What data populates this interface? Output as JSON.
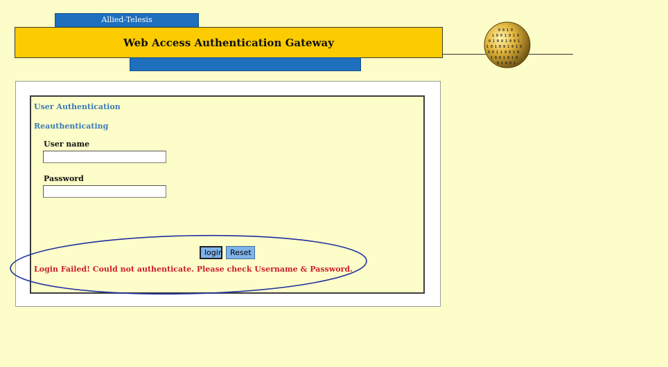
{
  "header": {
    "vendor": "Allied-Telesis",
    "title": "Web Access Authentication Gateway"
  },
  "form": {
    "heading": "User Authentication",
    "subheading": "Reauthenticating",
    "username_label": "User name",
    "username_value": "",
    "password_label": "Password",
    "password_value": "",
    "login_label": "login",
    "reset_label": "Reset",
    "error_message": "Login Failed! Could not authenticate. Please check Username & Password."
  },
  "colors": {
    "background": "#fdfdc9",
    "title_bar": "#fccb00",
    "tab_blue": "#1e6fbd",
    "heading_blue": "#3b7bb5",
    "error_red": "#cc1f2f",
    "annotation_ellipse": "#1c2fa0"
  },
  "icons": {
    "logo": "globe-icon"
  }
}
